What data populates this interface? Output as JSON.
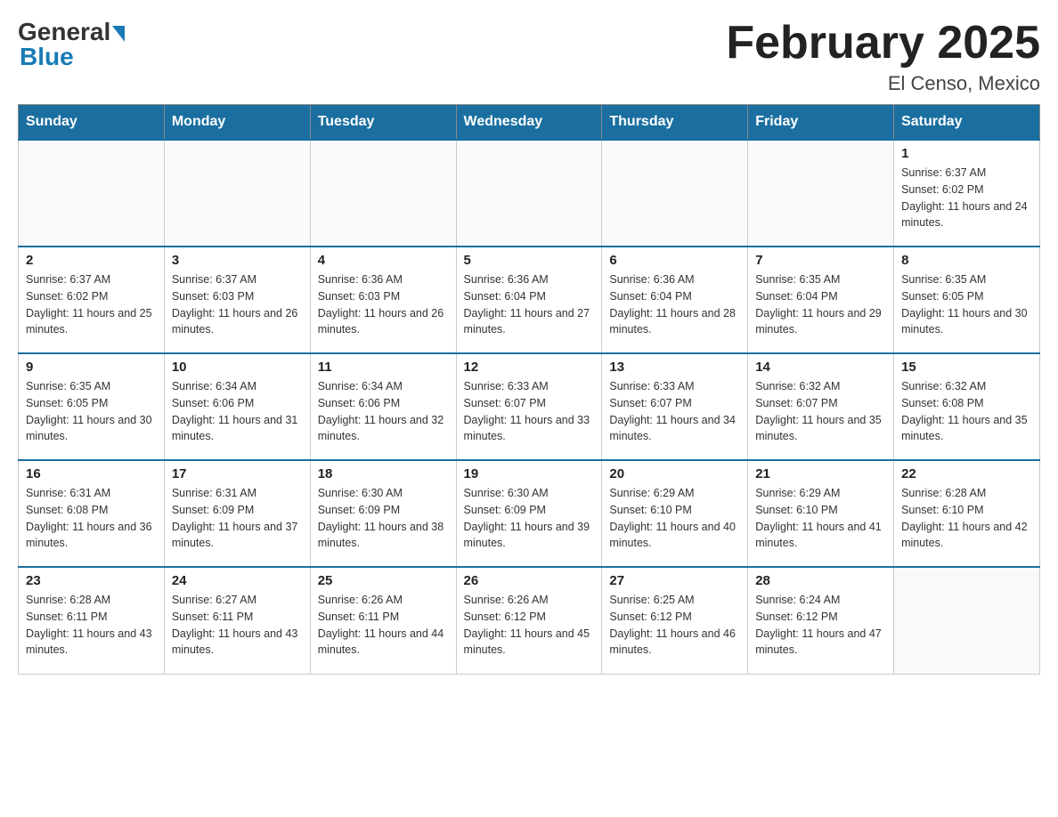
{
  "header": {
    "title": "February 2025",
    "location": "El Censo, Mexico",
    "logo_general": "General",
    "logo_blue": "Blue"
  },
  "days_of_week": [
    "Sunday",
    "Monday",
    "Tuesday",
    "Wednesday",
    "Thursday",
    "Friday",
    "Saturday"
  ],
  "weeks": [
    [
      {
        "day": "",
        "info": ""
      },
      {
        "day": "",
        "info": ""
      },
      {
        "day": "",
        "info": ""
      },
      {
        "day": "",
        "info": ""
      },
      {
        "day": "",
        "info": ""
      },
      {
        "day": "",
        "info": ""
      },
      {
        "day": "1",
        "info": "Sunrise: 6:37 AM\nSunset: 6:02 PM\nDaylight: 11 hours and 24 minutes."
      }
    ],
    [
      {
        "day": "2",
        "info": "Sunrise: 6:37 AM\nSunset: 6:02 PM\nDaylight: 11 hours and 25 minutes."
      },
      {
        "day": "3",
        "info": "Sunrise: 6:37 AM\nSunset: 6:03 PM\nDaylight: 11 hours and 26 minutes."
      },
      {
        "day": "4",
        "info": "Sunrise: 6:36 AM\nSunset: 6:03 PM\nDaylight: 11 hours and 26 minutes."
      },
      {
        "day": "5",
        "info": "Sunrise: 6:36 AM\nSunset: 6:04 PM\nDaylight: 11 hours and 27 minutes."
      },
      {
        "day": "6",
        "info": "Sunrise: 6:36 AM\nSunset: 6:04 PM\nDaylight: 11 hours and 28 minutes."
      },
      {
        "day": "7",
        "info": "Sunrise: 6:35 AM\nSunset: 6:04 PM\nDaylight: 11 hours and 29 minutes."
      },
      {
        "day": "8",
        "info": "Sunrise: 6:35 AM\nSunset: 6:05 PM\nDaylight: 11 hours and 30 minutes."
      }
    ],
    [
      {
        "day": "9",
        "info": "Sunrise: 6:35 AM\nSunset: 6:05 PM\nDaylight: 11 hours and 30 minutes."
      },
      {
        "day": "10",
        "info": "Sunrise: 6:34 AM\nSunset: 6:06 PM\nDaylight: 11 hours and 31 minutes."
      },
      {
        "day": "11",
        "info": "Sunrise: 6:34 AM\nSunset: 6:06 PM\nDaylight: 11 hours and 32 minutes."
      },
      {
        "day": "12",
        "info": "Sunrise: 6:33 AM\nSunset: 6:07 PM\nDaylight: 11 hours and 33 minutes."
      },
      {
        "day": "13",
        "info": "Sunrise: 6:33 AM\nSunset: 6:07 PM\nDaylight: 11 hours and 34 minutes."
      },
      {
        "day": "14",
        "info": "Sunrise: 6:32 AM\nSunset: 6:07 PM\nDaylight: 11 hours and 35 minutes."
      },
      {
        "day": "15",
        "info": "Sunrise: 6:32 AM\nSunset: 6:08 PM\nDaylight: 11 hours and 35 minutes."
      }
    ],
    [
      {
        "day": "16",
        "info": "Sunrise: 6:31 AM\nSunset: 6:08 PM\nDaylight: 11 hours and 36 minutes."
      },
      {
        "day": "17",
        "info": "Sunrise: 6:31 AM\nSunset: 6:09 PM\nDaylight: 11 hours and 37 minutes."
      },
      {
        "day": "18",
        "info": "Sunrise: 6:30 AM\nSunset: 6:09 PM\nDaylight: 11 hours and 38 minutes."
      },
      {
        "day": "19",
        "info": "Sunrise: 6:30 AM\nSunset: 6:09 PM\nDaylight: 11 hours and 39 minutes."
      },
      {
        "day": "20",
        "info": "Sunrise: 6:29 AM\nSunset: 6:10 PM\nDaylight: 11 hours and 40 minutes."
      },
      {
        "day": "21",
        "info": "Sunrise: 6:29 AM\nSunset: 6:10 PM\nDaylight: 11 hours and 41 minutes."
      },
      {
        "day": "22",
        "info": "Sunrise: 6:28 AM\nSunset: 6:10 PM\nDaylight: 11 hours and 42 minutes."
      }
    ],
    [
      {
        "day": "23",
        "info": "Sunrise: 6:28 AM\nSunset: 6:11 PM\nDaylight: 11 hours and 43 minutes."
      },
      {
        "day": "24",
        "info": "Sunrise: 6:27 AM\nSunset: 6:11 PM\nDaylight: 11 hours and 43 minutes."
      },
      {
        "day": "25",
        "info": "Sunrise: 6:26 AM\nSunset: 6:11 PM\nDaylight: 11 hours and 44 minutes."
      },
      {
        "day": "26",
        "info": "Sunrise: 6:26 AM\nSunset: 6:12 PM\nDaylight: 11 hours and 45 minutes."
      },
      {
        "day": "27",
        "info": "Sunrise: 6:25 AM\nSunset: 6:12 PM\nDaylight: 11 hours and 46 minutes."
      },
      {
        "day": "28",
        "info": "Sunrise: 6:24 AM\nSunset: 6:12 PM\nDaylight: 11 hours and 47 minutes."
      },
      {
        "day": "",
        "info": ""
      }
    ]
  ]
}
